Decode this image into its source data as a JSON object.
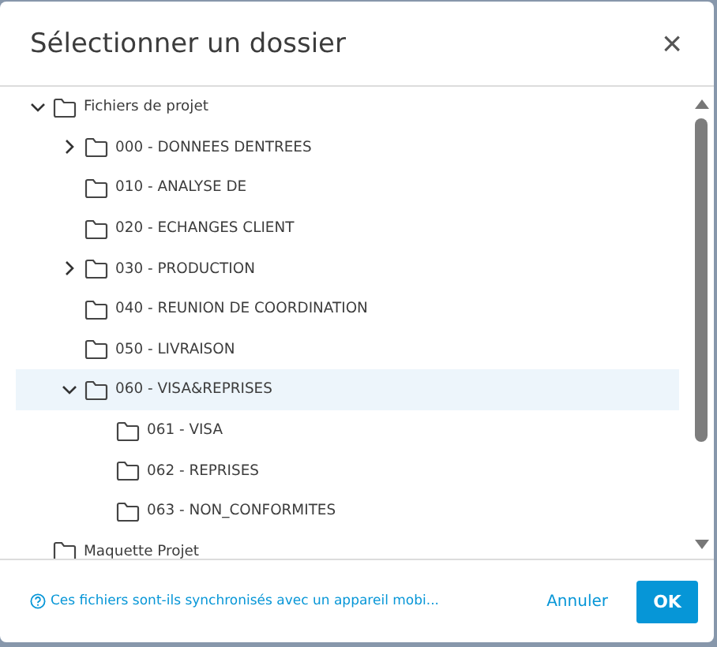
{
  "dialog": {
    "title": "Sélectionner un dossier",
    "close": "×"
  },
  "tree": [
    {
      "label": "Fichiers de projet",
      "expanded": true,
      "selected": false,
      "has_children": true,
      "children": [
        {
          "label": "000 - DONNEES DENTREES",
          "expanded": false,
          "selected": false,
          "has_children": true
        },
        {
          "label": "010 - ANALYSE DE",
          "expanded": false,
          "selected": false,
          "has_children": false
        },
        {
          "label": "020 - ECHANGES CLIENT",
          "expanded": false,
          "selected": false,
          "has_children": false
        },
        {
          "label": "030 - PRODUCTION",
          "expanded": false,
          "selected": false,
          "has_children": true
        },
        {
          "label": "040 - REUNION DE COORDINATION",
          "expanded": false,
          "selected": false,
          "has_children": false
        },
        {
          "label": "050 - LIVRAISON",
          "expanded": false,
          "selected": false,
          "has_children": false
        },
        {
          "label": "060 - VISA&REPRISES",
          "expanded": true,
          "selected": true,
          "has_children": true,
          "children": [
            {
              "label": "061 - VISA",
              "expanded": false,
              "selected": false,
              "has_children": false
            },
            {
              "label": "062 - REPRISES",
              "expanded": false,
              "selected": false,
              "has_children": false
            },
            {
              "label": "063 - NON_CONFORMITES",
              "expanded": false,
              "selected": false,
              "has_children": false
            }
          ]
        }
      ]
    },
    {
      "label": "Maquette Projet",
      "expanded": false,
      "selected": false,
      "has_children": false
    }
  ],
  "footer": {
    "help_link": "Ces fichiers sont-ils synchronisés avec un appareil mobi...",
    "cancel": "Annuler",
    "ok": "OK"
  }
}
